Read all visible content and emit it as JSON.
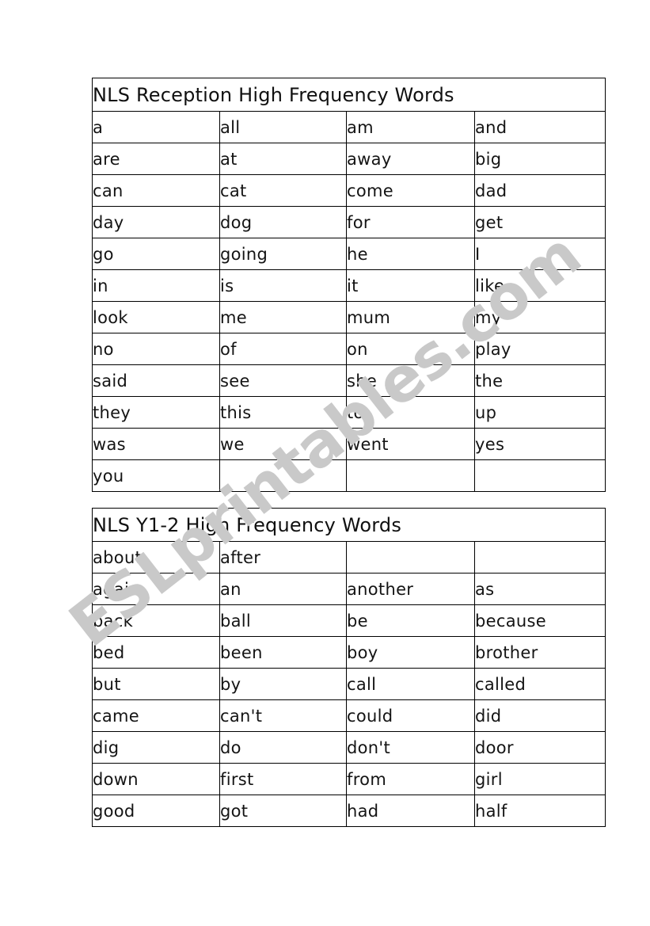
{
  "page": {
    "background_color": "#ffffff",
    "border_color": "#000000"
  },
  "watermark": {
    "text": "ESLprintables.com",
    "color": "#c9c9c9",
    "rotation_degrees": -38
  },
  "tables": [
    {
      "id": "reception",
      "title": "NLS Reception High Frequency Words",
      "columns": 4,
      "rows": [
        [
          "a",
          "all",
          "am",
          "and"
        ],
        [
          "are",
          "at",
          "away",
          "big"
        ],
        [
          "can",
          "cat",
          "come",
          "dad"
        ],
        [
          "day",
          "dog",
          "for",
          "get"
        ],
        [
          "go",
          "going",
          "he",
          "I"
        ],
        [
          "in",
          "is",
          "it",
          "like"
        ],
        [
          "look",
          "me",
          "mum",
          "my"
        ],
        [
          "no",
          "of",
          "on",
          "play"
        ],
        [
          "said",
          "see",
          "she",
          "the"
        ],
        [
          "they",
          "this",
          "to",
          "up"
        ],
        [
          "was",
          "we",
          "went",
          "yes"
        ],
        [
          "you",
          "",
          "",
          ""
        ]
      ]
    },
    {
      "id": "y12",
      "title": "NLS Y1-2 High Frequency Words",
      "columns": 4,
      "rows": [
        [
          "about",
          "after",
          "",
          ""
        ],
        [
          "again",
          "an",
          "another",
          "as"
        ],
        [
          "back",
          "ball",
          "be",
          "because"
        ],
        [
          "bed",
          "been",
          "boy",
          "brother"
        ],
        [
          "but",
          "by",
          "call",
          "called"
        ],
        [
          "came",
          "can't",
          "could",
          "did"
        ],
        [
          "dig",
          "do",
          "don't",
          "door"
        ],
        [
          "down",
          "first",
          "from",
          "girl"
        ],
        [
          "good",
          "got",
          "had",
          "half"
        ]
      ]
    }
  ]
}
